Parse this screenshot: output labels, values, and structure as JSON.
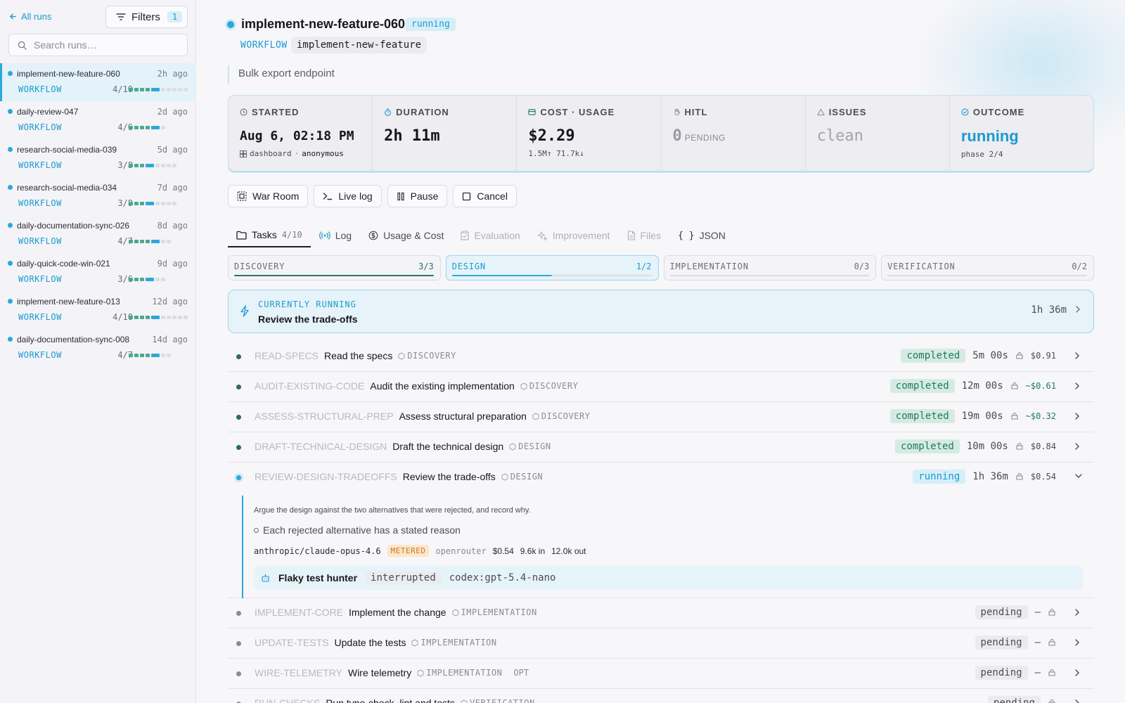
{
  "sidebar": {
    "back_label": "All runs",
    "filters_label": "Filters",
    "filters_count": "1",
    "search_placeholder": "Search runs…",
    "runs": [
      {
        "name": "implement-new-feature-060",
        "age": "2h ago",
        "kind": "WORKFLOW",
        "progress": "4/10",
        "done": 4,
        "total": 10,
        "active": true
      },
      {
        "name": "daily-review-047",
        "age": "2d ago",
        "kind": "WORKFLOW",
        "progress": "4/6",
        "done": 4,
        "total": 6,
        "active": false
      },
      {
        "name": "research-social-media-039",
        "age": "5d ago",
        "kind": "WORKFLOW",
        "progress": "3/8",
        "done": 3,
        "total": 8,
        "active": false
      },
      {
        "name": "research-social-media-034",
        "age": "7d ago",
        "kind": "WORKFLOW",
        "progress": "3/8",
        "done": 3,
        "total": 8,
        "active": false
      },
      {
        "name": "daily-documentation-sync-026",
        "age": "8d ago",
        "kind": "WORKFLOW",
        "progress": "4/7",
        "done": 4,
        "total": 7,
        "active": false
      },
      {
        "name": "daily-quick-code-win-021",
        "age": "9d ago",
        "kind": "WORKFLOW",
        "progress": "3/6",
        "done": 3,
        "total": 6,
        "active": false
      },
      {
        "name": "implement-new-feature-013",
        "age": "12d ago",
        "kind": "WORKFLOW",
        "progress": "4/10",
        "done": 4,
        "total": 10,
        "active": false
      },
      {
        "name": "daily-documentation-sync-008",
        "age": "14d ago",
        "kind": "WORKFLOW",
        "progress": "4/7",
        "done": 4,
        "total": 7,
        "active": false
      }
    ]
  },
  "header": {
    "title": "implement-new-feature-060",
    "status": "running",
    "workflow_label": "WORKFLOW",
    "workflow_name": "implement-new-feature",
    "subtitle": "Bulk export endpoint"
  },
  "stats": {
    "started": {
      "label": "STARTED",
      "value": "Aug 6, 02:18 PM",
      "source": "dashboard",
      "user": "anonymous"
    },
    "duration": {
      "label": "DURATION",
      "value": "2h 11m"
    },
    "cost": {
      "label": "COST · USAGE",
      "value": "$2.29",
      "sub": "1.5M↑ 71.7k↓"
    },
    "hitl": {
      "label": "HITL",
      "value": "0",
      "sub": "PENDING"
    },
    "issues": {
      "label": "ISSUES",
      "value": "clean"
    },
    "outcome": {
      "label": "OUTCOME",
      "value": "running",
      "sub": "phase 2/4"
    }
  },
  "actions": {
    "war_room": "War Room",
    "live_log": "Live log",
    "pause": "Pause",
    "cancel": "Cancel"
  },
  "tabs": {
    "tasks": "Tasks",
    "tasks_count": "4/10",
    "log": "Log",
    "usage": "Usage & Cost",
    "evaluation": "Evaluation",
    "improvement": "Improvement",
    "files": "Files",
    "json": "JSON"
  },
  "phases": [
    {
      "name": "DISCOVERY",
      "count": "3/3",
      "fraction": 1.0,
      "color": "#1e7b5d"
    },
    {
      "name": "DESIGN",
      "count": "1/2",
      "fraction": 0.5,
      "color": "#2aa8dc"
    },
    {
      "name": "IMPLEMENTATION",
      "count": "0/3",
      "fraction": 0,
      "color": "#2aa8dc"
    },
    {
      "name": "VERIFICATION",
      "count": "0/2",
      "fraction": 0,
      "color": "#2aa8dc"
    }
  ],
  "current": {
    "label": "CURRENTLY RUNNING",
    "title": "Review the trade-offs",
    "time": "1h 36m"
  },
  "tasks": [
    {
      "id": "READ-SPECS",
      "title": "Read the specs",
      "phase": "DISCOVERY",
      "status": "completed",
      "duration": "5m 00s",
      "cost": "$0.91",
      "est": false
    },
    {
      "id": "AUDIT-EXISTING-CODE",
      "title": "Audit the existing implementation",
      "phase": "DISCOVERY",
      "status": "completed",
      "duration": "12m 00s",
      "cost": "~$0.61",
      "est": true
    },
    {
      "id": "ASSESS-STRUCTURAL-PREP",
      "title": "Assess structural preparation",
      "phase": "DISCOVERY",
      "status": "completed",
      "duration": "19m 00s",
      "cost": "~$0.32",
      "est": true
    },
    {
      "id": "DRAFT-TECHNICAL-DESIGN",
      "title": "Draft the technical design",
      "phase": "DESIGN",
      "status": "completed",
      "duration": "10m 00s",
      "cost": "$0.84",
      "est": false
    },
    {
      "id": "REVIEW-DESIGN-TRADEOFFS",
      "title": "Review the trade-offs",
      "phase": "DESIGN",
      "status": "running",
      "duration": "1h 36m",
      "cost": "$0.54",
      "est": false
    }
  ],
  "expanded": {
    "description": "Argue the design against the two alternatives that were rejected, and record why.",
    "criterion": "Each rejected alternative has a stated reason",
    "model": "anthropic/claude-opus-4.6",
    "billing": "METERED",
    "provider": "openrouter",
    "cost": "$0.54",
    "tokens_in": "9.6k in",
    "tokens_out": "12.0k out",
    "agent_name": "Flaky test hunter",
    "agent_status": "interrupted",
    "agent_model": "codex:gpt-5.4-nano"
  },
  "pending_tasks": [
    {
      "id": "IMPLEMENT-CORE",
      "title": "Implement the change",
      "phase": "IMPLEMENTATION",
      "status": "pending",
      "duration": "—",
      "opt": ""
    },
    {
      "id": "UPDATE-TESTS",
      "title": "Update the tests",
      "phase": "IMPLEMENTATION",
      "status": "pending",
      "duration": "—",
      "opt": ""
    },
    {
      "id": "WIRE-TELEMETRY",
      "title": "Wire telemetry",
      "phase": "IMPLEMENTATION",
      "status": "pending",
      "duration": "—",
      "opt": "OPT"
    },
    {
      "id": "RUN-CHECKS",
      "title": "Run type-check, lint and tests",
      "phase": "VERIFICATION",
      "status": "pending",
      "duration": "",
      "opt": ""
    }
  ]
}
